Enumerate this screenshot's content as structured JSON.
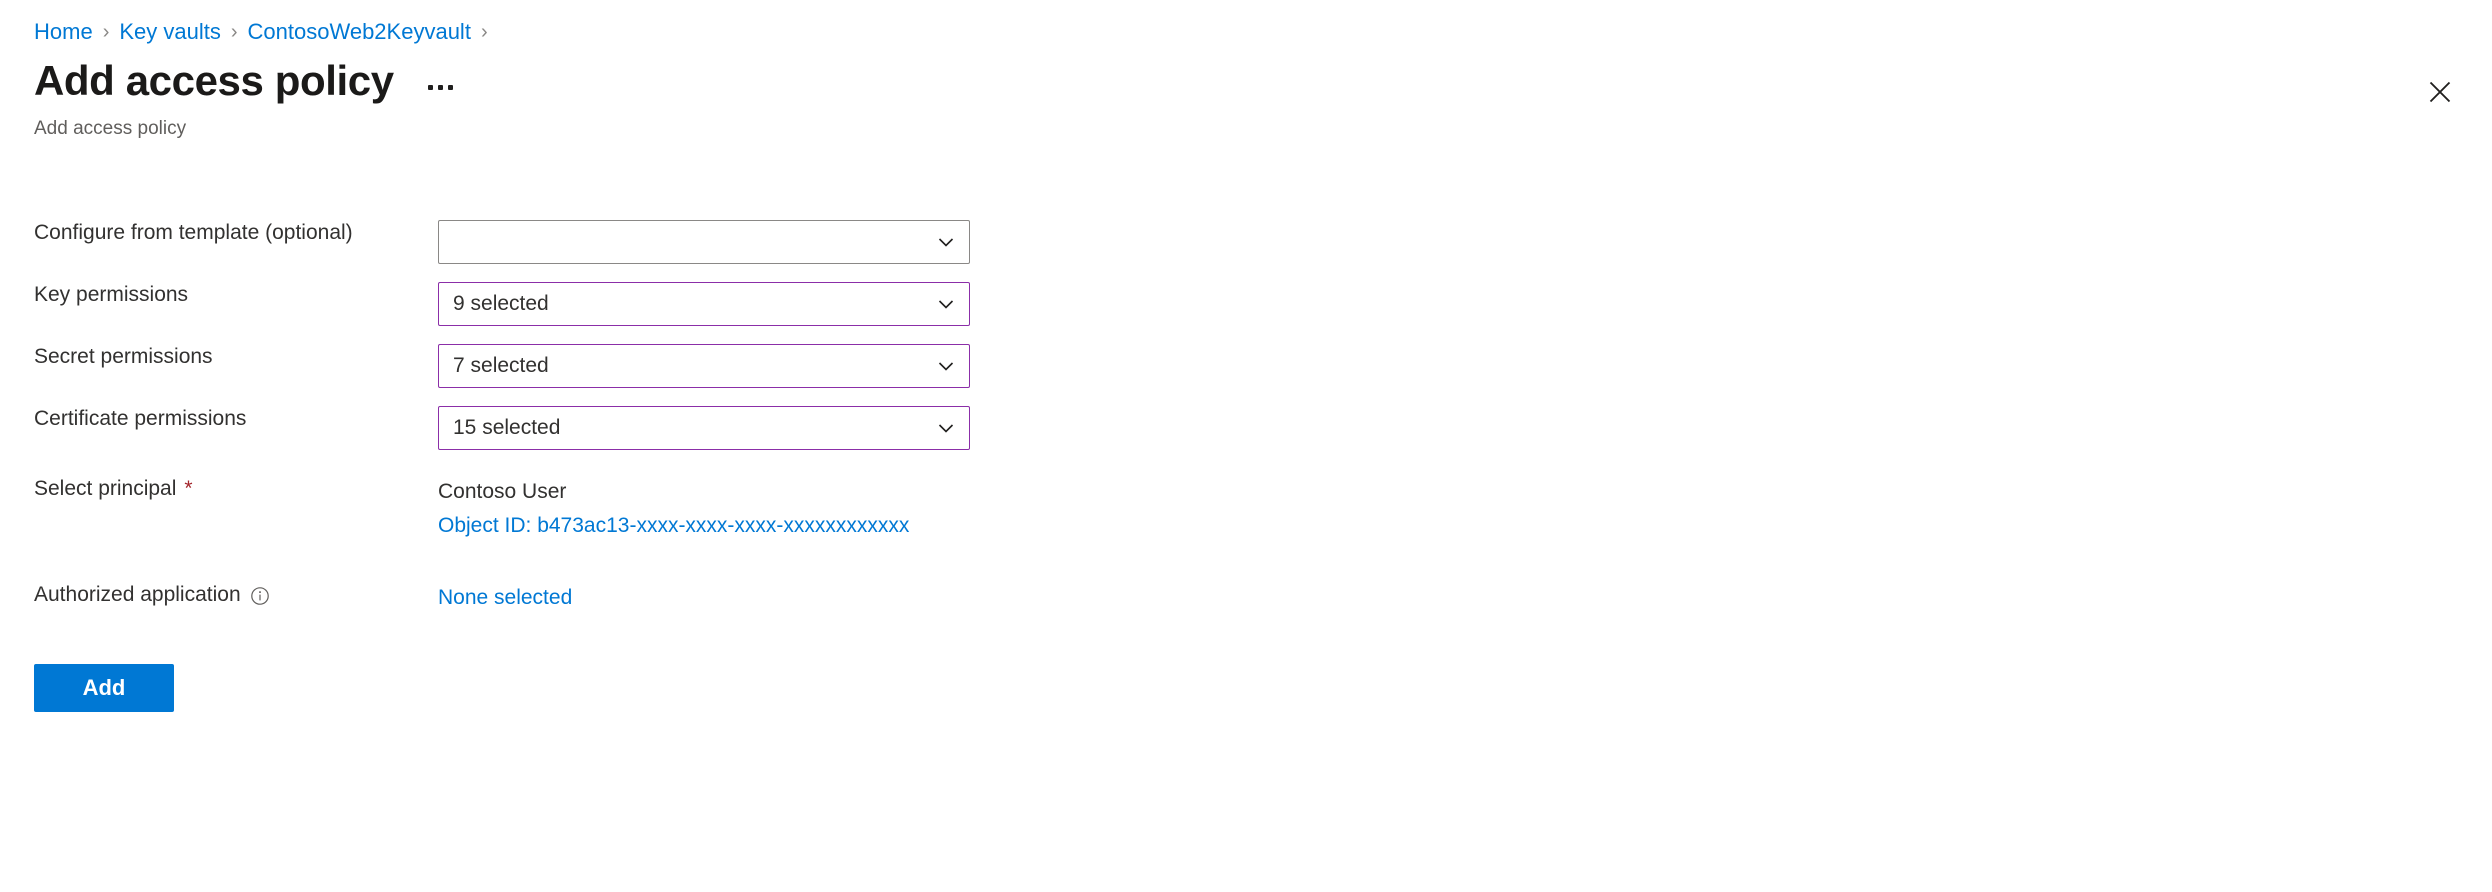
{
  "breadcrumb": {
    "items": [
      {
        "label": "Home"
      },
      {
        "label": "Key vaults"
      },
      {
        "label": "ContosoWeb2Keyvault"
      }
    ],
    "separator": "›",
    "trailing_separator": "›"
  },
  "header": {
    "title": "Add access policy",
    "subtitle": "Add access policy",
    "more_menu_name": "more-commands",
    "close_label": "Close"
  },
  "form": {
    "template_field": {
      "label": "Configure from template (optional)",
      "value": "",
      "placeholder": ""
    },
    "key_permissions": {
      "label": "Key permissions",
      "value": "9 selected"
    },
    "secret_permissions": {
      "label": "Secret permissions",
      "value": "7 selected"
    },
    "certificate_permissions": {
      "label": "Certificate permissions",
      "value": "15 selected"
    },
    "select_principal": {
      "label": "Select principal",
      "required_marker": "*",
      "principal_name": "Contoso User",
      "object_id": "Object ID: b473ac13-xxxx-xxxx-xxxx-xxxxxxxxxxxx"
    },
    "authorized_application": {
      "label": "Authorized application",
      "info_glyph": "i",
      "value": "None selected"
    }
  },
  "actions": {
    "add_label": "Add"
  },
  "colors": {
    "link": "#0078d4",
    "primary_button": "#0078d4",
    "selected_border": "#8b2ea8",
    "default_border": "#8a8886",
    "required": "#a4262c",
    "text": "#323130",
    "muted_text": "#605e5c"
  }
}
